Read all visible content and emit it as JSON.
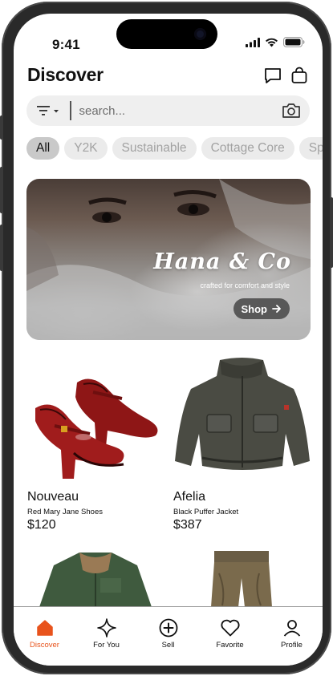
{
  "status_bar": {
    "time": "9:41"
  },
  "header": {
    "title": "Discover"
  },
  "search": {
    "placeholder": "search..."
  },
  "chips": [
    "All",
    "Y2K",
    "Sustainable",
    "Cottage Core",
    "Sp"
  ],
  "banner": {
    "brand": "Hana & Co",
    "tagline": "crafted for comfort and style",
    "cta": "Shop"
  },
  "products": [
    {
      "brand": "Nouveau",
      "name": "Red Mary Jane Shoes",
      "price": "$120"
    },
    {
      "brand": "Afelia",
      "name": "Black Puffer Jacket",
      "price": "$387"
    }
  ],
  "tabbar": {
    "items": [
      {
        "label": "For You",
        "icon": "sparkle-icon"
      },
      {
        "label": "Sell",
        "icon": "plus-circle-icon"
      },
      {
        "label": "Favorite",
        "icon": "heart-icon"
      },
      {
        "label": "Profile",
        "icon": "person-icon"
      }
    ],
    "active": {
      "label": "Discover",
      "icon": "home-icon"
    }
  },
  "colors": {
    "accent": "#e8531c",
    "chip_active_bg": "#c9c9c9",
    "chip_bg": "#ebebeb",
    "search_bg": "#efefef"
  }
}
